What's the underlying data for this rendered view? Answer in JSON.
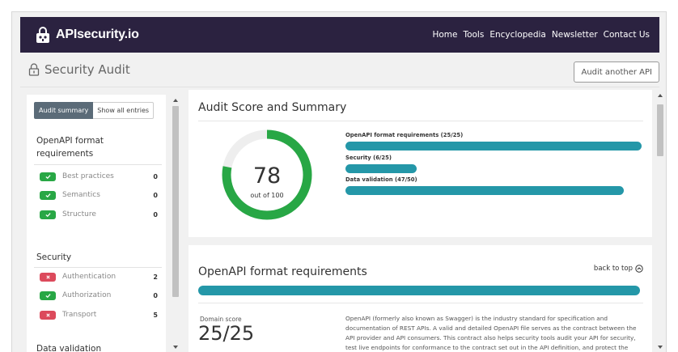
{
  "navbar": {
    "logo_text": "APIsecurity.io",
    "links": [
      "Home",
      "Tools",
      "Encyclopedia",
      "Newsletter",
      "Contact Us"
    ],
    "background": "#2b2240"
  },
  "header": {
    "title": "Security Audit",
    "audit_another_label": "Audit another API"
  },
  "sidebar": {
    "toggle_summary": "Audit summary",
    "toggle_all": "Show all entries",
    "groups": [
      {
        "title": "OpenAPI format requirements",
        "items": [
          {
            "label": "Best practices",
            "count": "0",
            "status": "ok"
          },
          {
            "label": "Semantics",
            "count": "0",
            "status": "ok"
          },
          {
            "label": "Structure",
            "count": "0",
            "status": "ok"
          }
        ]
      },
      {
        "title": "Security",
        "items": [
          {
            "label": "Authentication",
            "count": "2",
            "status": "fail"
          },
          {
            "label": "Authorization",
            "count": "0",
            "status": "ok"
          },
          {
            "label": "Transport",
            "count": "5",
            "status": "fail"
          }
        ]
      },
      {
        "title": "Data validation",
        "items": []
      }
    ]
  },
  "summary": {
    "title": "Audit Score and Summary",
    "score": "78",
    "score_sub": "out of 100",
    "score_value": 78,
    "score_max": 100,
    "bars": [
      {
        "label": "OpenAPI format requirements (25/25)",
        "value": 25,
        "max": 25
      },
      {
        "label": "Security (6/25)",
        "value": 6,
        "max": 25
      },
      {
        "label": "Data validation (47/50)",
        "value": 47,
        "max": 50
      }
    ],
    "colors": {
      "gauge": "#28a745",
      "gauge_track": "#eeeeee",
      "bar": "#2497a8"
    }
  },
  "openapi_section": {
    "title": "OpenAPI format requirements",
    "back_to_top": "back to top",
    "bar_value": 25,
    "bar_max": 25,
    "domain_label": "Domain score",
    "domain_score": "25/25",
    "description": "OpenAPI (formerly also known as Swagger) is the industry standard for specification and documentation of REST APIs. A valid and detailed OpenAPI file serves as the contract between the API provider and API consumers. This contract also helps security tools audit your API for security, test live endpoints for conformance to the contract set out in the API definition, and protect the endpoint at runtime."
  }
}
